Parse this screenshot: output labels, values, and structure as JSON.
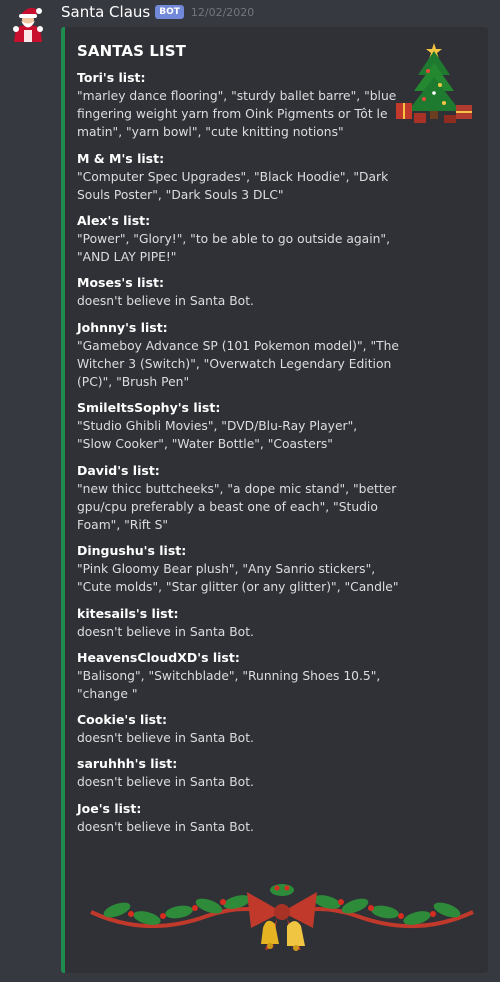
{
  "message": {
    "author": "Santa Claus",
    "bot_tag": "BOT",
    "timestamp": "12/02/2020",
    "avatar_icon": "santa-avatar-icon"
  },
  "embed": {
    "accent_color": "#1f8b4c",
    "title": "SANTAS LIST",
    "thumbnail_icon": "christmas-tree-icon",
    "image_icon": "holly-garland-with-bells-icon",
    "fields": [
      {
        "name": "Tori's list:",
        "value": "\"marley dance flooring\", \"sturdy ballet barre\", \"blue\nfingering weight yarn from Oink Pigments or Tôt le\nmatin\", \"yarn bowl\", \"cute knitting notions\""
      },
      {
        "name": "M & M's list:",
        "value": "\"Computer Spec Upgrades\", \"Black Hoodie\", \"Dark\nSouls Poster\", \"Dark Souls 3 DLC\""
      },
      {
        "name": "Alex's list:",
        "value": "\"Power\", \"Glory!\", \"to be able to go outside again\",\n\"AND LAY PIPE!\""
      },
      {
        "name": "Moses's list:",
        "value": "doesn't believe in Santa Bot."
      },
      {
        "name": "Johnny's list:",
        "value": "\"Gameboy Advance SP (101 Pokemon model)\", \"The\nWitcher 3 (Switch)\", \"Overwatch Legendary Edition\n(PC)\", \"Brush Pen\""
      },
      {
        "name": "SmileItsSophy's list:",
        "value": "\"Studio Ghibli Movies\", \"DVD/Blu-Ray Player\",\n\"Slow Cooker\", \"Water Bottle\", \"Coasters\""
      },
      {
        "name": "David's list:",
        "value": "\"new thicc buttcheeks\", \"a dope mic stand\", \"better\ngpu/cpu preferably a beast one of each\", \"Studio\nFoam\", \"Rift S\""
      },
      {
        "name": "Dingushu's list:",
        "value": "\"Pink Gloomy Bear plush\", \"Any Sanrio stickers\",\n\"Cute molds\", \"Star glitter (or any glitter)\", \"Candle\""
      },
      {
        "name": "kitesails's list:",
        "value": "doesn't believe in Santa Bot."
      },
      {
        "name": "HeavensCloudXD's list:",
        "value": "\"Balisong\", \"Switchblade\", \"Running Shoes 10.5\",\n\"change \""
      },
      {
        "name": "Cookie's list:",
        "value": "doesn't believe in Santa Bot."
      },
      {
        "name": "saruhhh's list:",
        "value": "doesn't believe in Santa Bot."
      },
      {
        "name": "Joe's list:",
        "value": "doesn't believe in Santa Bot."
      }
    ]
  }
}
